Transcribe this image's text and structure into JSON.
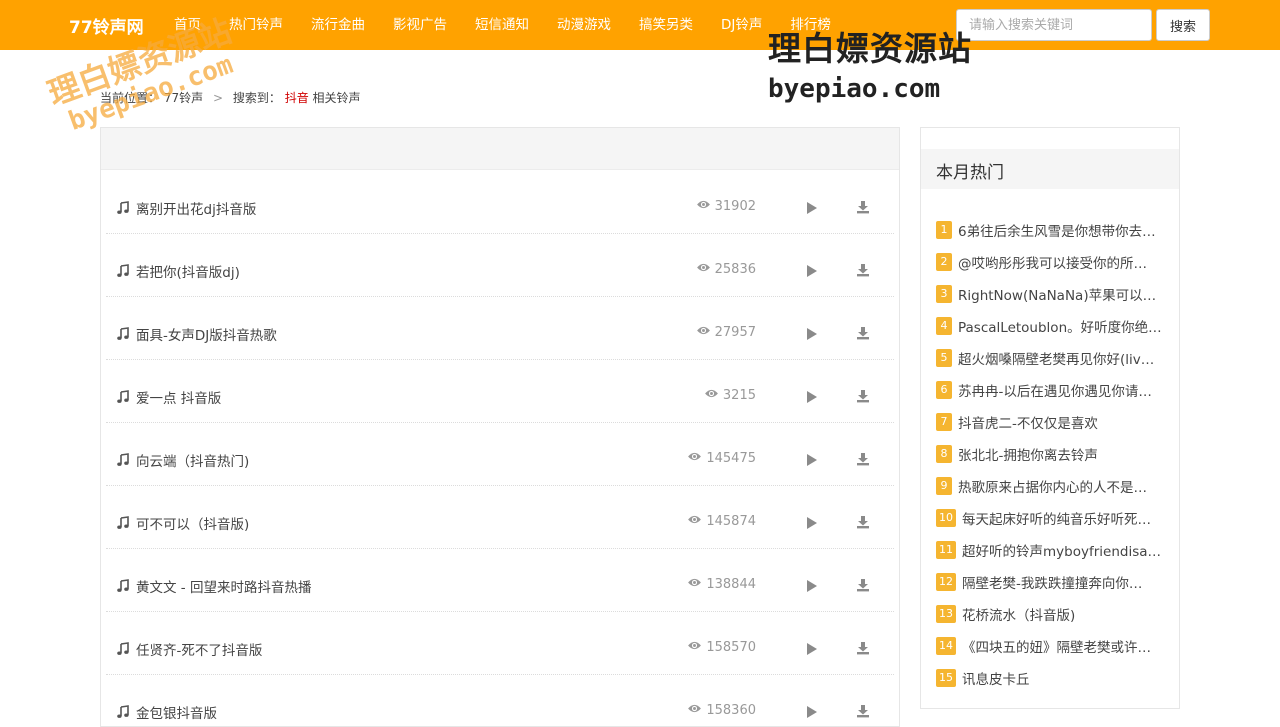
{
  "header": {
    "brand": "77铃声网",
    "nav": [
      "首页",
      "热门铃声",
      "流行金曲",
      "影视广告",
      "短信通知",
      "动漫游戏",
      "搞笑另类",
      "DJ铃声",
      "排行榜"
    ],
    "search": {
      "placeholder": "请输入搜索关键词",
      "button": "搜索"
    }
  },
  "breadcrumb": {
    "prefix": "当前位置：",
    "home": "77铃声",
    "sep": ">",
    "search_label": "搜索到：",
    "keyword": "抖音",
    "suffix": "相关铃声"
  },
  "ringtones": [
    {
      "title": "离别开出花dj抖音版",
      "views": "31902"
    },
    {
      "title": "若把你(抖音版dj)",
      "views": "25836"
    },
    {
      "title": "面具-女声DJ版抖音热歌",
      "views": "27957"
    },
    {
      "title": "爱一点 抖音版",
      "views": "3215"
    },
    {
      "title": "向云端（抖音热门)",
      "views": "145475"
    },
    {
      "title": "可不可以（抖音版)",
      "views": "145874"
    },
    {
      "title": "黄文文 - 回望来时路抖音热播",
      "views": "138844"
    },
    {
      "title": "任贤齐-死不了抖音版",
      "views": "158570"
    },
    {
      "title": "金包银抖音版",
      "views": "158360"
    }
  ],
  "sidebar": {
    "title": "本月热门",
    "items": [
      {
        "num": "1",
        "text": "6弟往后余生风雪是你想带你去…"
      },
      {
        "num": "2",
        "text": "@哎哟彤彤我可以接受你的所…"
      },
      {
        "num": "3",
        "text": "RightNow(NaNaNa)苹果可以…"
      },
      {
        "num": "4",
        "text": "PascalLetoublon。好听度你绝…"
      },
      {
        "num": "5",
        "text": "超火烟嗓隔壁老樊再见你好(liv…"
      },
      {
        "num": "6",
        "text": "苏冉冉-以后在遇见你遇见你请…"
      },
      {
        "num": "7",
        "text": "抖音虎二-不仅仅是喜欢"
      },
      {
        "num": "8",
        "text": "张北北-拥抱你离去铃声"
      },
      {
        "num": "9",
        "text": "热歌原来占据你内心的人不是…"
      },
      {
        "num": "10",
        "text": "每天起床好听的纯音乐好听死…"
      },
      {
        "num": "11",
        "text": "超好听的铃声myboyfriendisag…"
      },
      {
        "num": "12",
        "text": "隔壁老樊-我跌跌撞撞奔向你…"
      },
      {
        "num": "13",
        "text": "花桥流水（抖音版)"
      },
      {
        "num": "14",
        "text": "《四块五的妞》隔壁老樊或许…"
      },
      {
        "num": "15",
        "text": "讯息皮卡丘"
      }
    ]
  },
  "watermarks": {
    "main": "理白嫖资源站",
    "domain": "byepiao.com"
  },
  "colors": {
    "nav_bg": "#ffa200",
    "badge": "#f5b530",
    "keyword": "#d00000"
  },
  "icons": {
    "row": "music-note-icon",
    "views": "eye-icon",
    "play": "play-icon",
    "download": "download-icon"
  }
}
